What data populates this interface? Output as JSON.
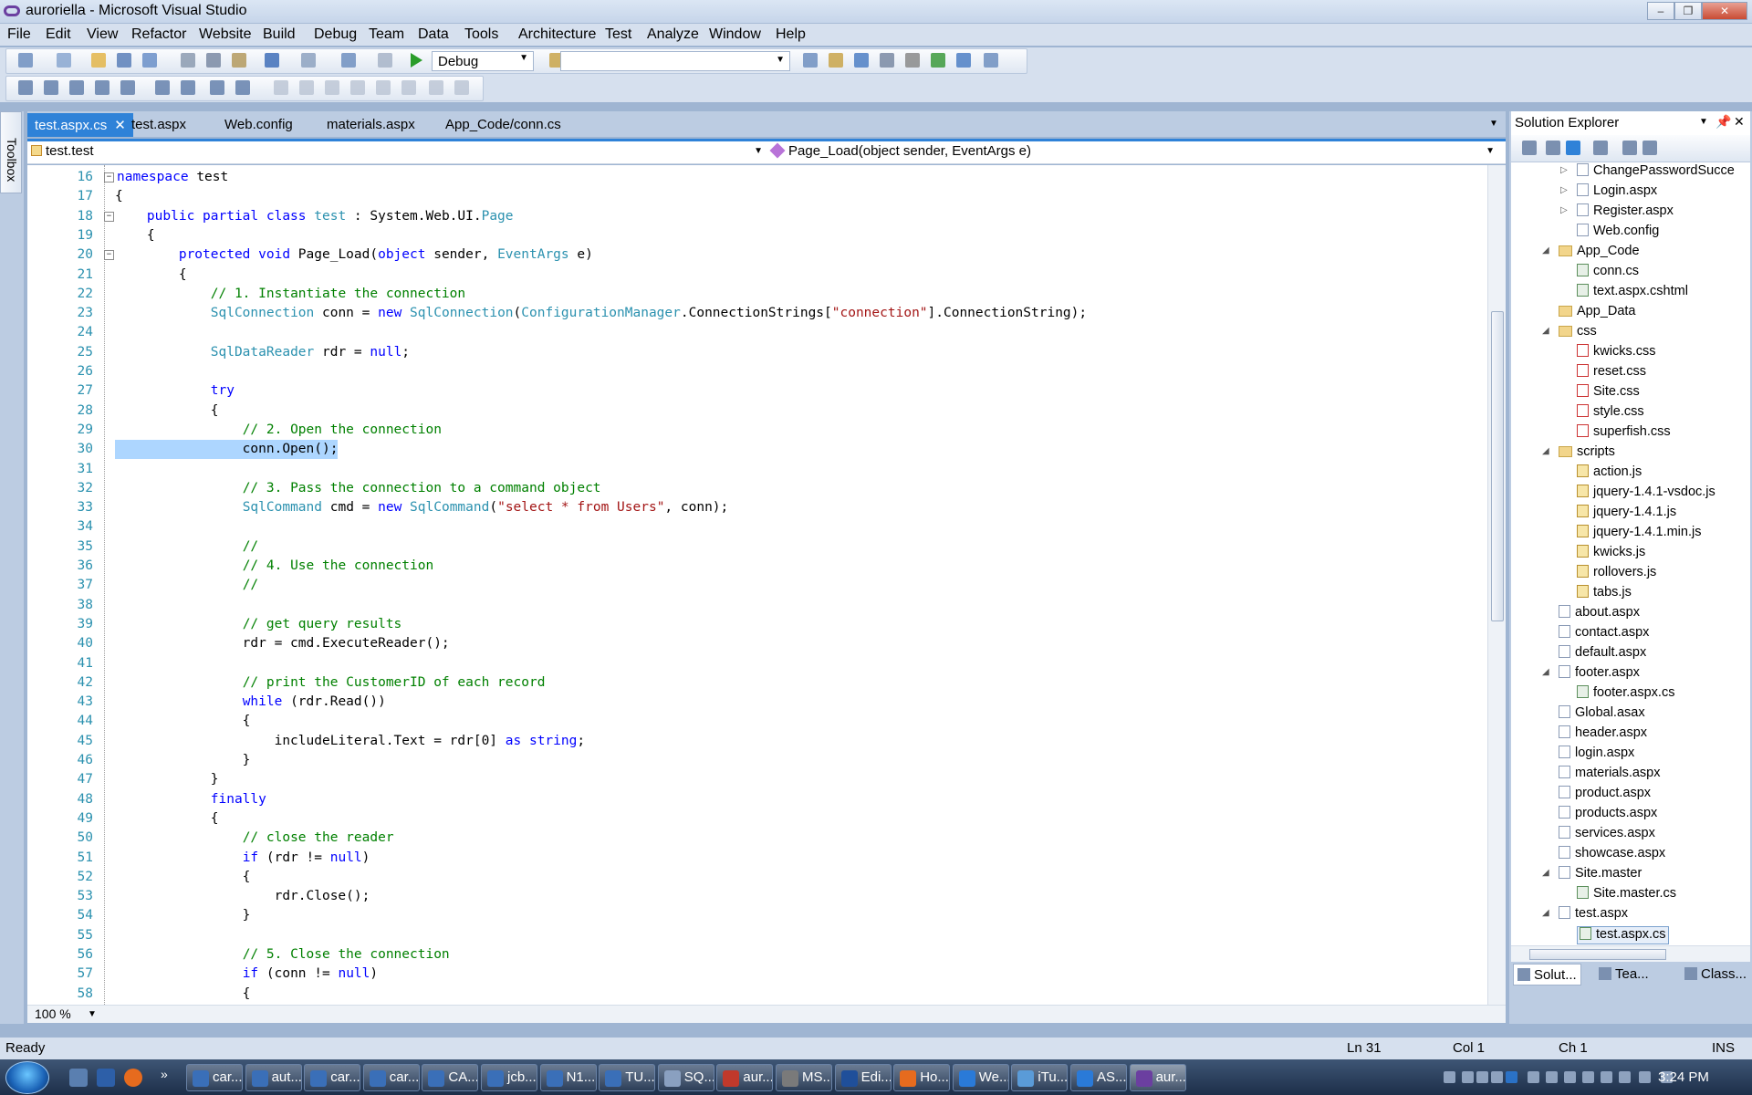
{
  "window": {
    "title": "auroriella - Microsoft Visual Studio",
    "minimize": "–",
    "maximize": "❐",
    "close": "✕"
  },
  "menu": [
    "File",
    "Edit",
    "View",
    "Refactor",
    "Website",
    "Build",
    "Debug",
    "Team",
    "Data",
    "Tools",
    "Architecture",
    "Test",
    "Analyze",
    "Window",
    "Help"
  ],
  "toolbar": {
    "config": "Debug",
    "start_icon": "play-icon"
  },
  "toolbox": {
    "label": "Toolbox"
  },
  "tabs": [
    {
      "label": "test.aspx.cs",
      "active": true
    },
    {
      "label": "test.aspx"
    },
    {
      "label": "Web.config"
    },
    {
      "label": "materials.aspx"
    },
    {
      "label": "App_Code/conn.cs"
    }
  ],
  "nav": {
    "class_combo": "test.test",
    "member_combo": "Page_Load(object sender, EventArgs e)"
  },
  "editor": {
    "zoom": "100 %",
    "lines": [
      {
        "n": "16",
        "fold": "-",
        "t": [
          [
            "kw",
            "namespace"
          ],
          [
            "",
            "test"
          ]
        ],
        "indent": 0,
        "raw": true
      },
      {
        "n": "17",
        "t": [
          [
            "",
            "{"
          ]
        ]
      },
      {
        "n": "18",
        "fold": "-",
        "t": [
          [
            "",
            "    "
          ],
          [
            "kw",
            "public partial class"
          ],
          [
            "",
            " "
          ],
          [
            "ty",
            "test"
          ],
          [
            "",
            " : System.Web.UI."
          ],
          [
            "ty",
            "Page"
          ]
        ]
      },
      {
        "n": "19",
        "t": [
          [
            "",
            "    {"
          ]
        ]
      },
      {
        "n": "20",
        "fold": "-",
        "t": [
          [
            "",
            "        "
          ],
          [
            "kw",
            "protected void"
          ],
          [
            "",
            " Page_Load("
          ],
          [
            "kw",
            "object"
          ],
          [
            "",
            " sender, "
          ],
          [
            "ty",
            "EventArgs"
          ],
          [
            "",
            " e)"
          ]
        ]
      },
      {
        "n": "21",
        "t": [
          [
            "",
            "        {"
          ]
        ]
      },
      {
        "n": "22",
        "t": [
          [
            "",
            "            "
          ],
          [
            "cm",
            "// 1. Instantiate the connection"
          ]
        ]
      },
      {
        "n": "23",
        "t": [
          [
            "",
            "            "
          ],
          [
            "ty",
            "SqlConnection"
          ],
          [
            "",
            " conn = "
          ],
          [
            "kw",
            "new"
          ],
          [
            "",
            " "
          ],
          [
            "ty",
            "SqlConnection"
          ],
          [
            "",
            "("
          ],
          [
            "ty",
            "ConfigurationManager"
          ],
          [
            "",
            ".ConnectionStrings["
          ],
          [
            "st",
            "\"connection\""
          ],
          [
            "",
            "].ConnectionString);"
          ]
        ]
      },
      {
        "n": "24",
        "t": [
          [
            "",
            ""
          ]
        ]
      },
      {
        "n": "25",
        "t": [
          [
            "",
            "            "
          ],
          [
            "ty",
            "SqlDataReader"
          ],
          [
            "",
            " rdr = "
          ],
          [
            "kw",
            "null"
          ],
          [
            "",
            ";"
          ]
        ]
      },
      {
        "n": "26",
        "t": [
          [
            "",
            ""
          ]
        ]
      },
      {
        "n": "27",
        "t": [
          [
            "",
            "            "
          ],
          [
            "kw",
            "try"
          ]
        ]
      },
      {
        "n": "28",
        "t": [
          [
            "",
            "            {"
          ]
        ]
      },
      {
        "n": "29",
        "t": [
          [
            "",
            "                "
          ],
          [
            "cm",
            "// 2. Open the connection"
          ]
        ]
      },
      {
        "n": "30",
        "hl": true,
        "t": [
          [
            "",
            "                conn.Open();"
          ]
        ]
      },
      {
        "n": "31",
        "t": [
          [
            "",
            ""
          ]
        ]
      },
      {
        "n": "32",
        "t": [
          [
            "",
            "                "
          ],
          [
            "cm",
            "// 3. Pass the connection to a command object"
          ]
        ]
      },
      {
        "n": "33",
        "t": [
          [
            "",
            "                "
          ],
          [
            "ty",
            "SqlCommand"
          ],
          [
            "",
            " cmd = "
          ],
          [
            "kw",
            "new"
          ],
          [
            "",
            " "
          ],
          [
            "ty",
            "SqlCommand"
          ],
          [
            "",
            "("
          ],
          [
            "st",
            "\"select * from Users\""
          ],
          [
            "",
            ", conn);"
          ]
        ]
      },
      {
        "n": "34",
        "t": [
          [
            "",
            ""
          ]
        ]
      },
      {
        "n": "35",
        "t": [
          [
            "",
            "                "
          ],
          [
            "cm",
            "//"
          ]
        ]
      },
      {
        "n": "36",
        "t": [
          [
            "",
            "                "
          ],
          [
            "cm",
            "// 4. Use the connection"
          ]
        ]
      },
      {
        "n": "37",
        "t": [
          [
            "",
            "                "
          ],
          [
            "cm",
            "//"
          ]
        ]
      },
      {
        "n": "38",
        "t": [
          [
            "",
            ""
          ]
        ]
      },
      {
        "n": "39",
        "t": [
          [
            "",
            "                "
          ],
          [
            "cm",
            "// get query results"
          ]
        ]
      },
      {
        "n": "40",
        "t": [
          [
            "",
            "                rdr = cmd.ExecuteReader();"
          ]
        ]
      },
      {
        "n": "41",
        "t": [
          [
            "",
            ""
          ]
        ]
      },
      {
        "n": "42",
        "t": [
          [
            "",
            "                "
          ],
          [
            "cm",
            "// print the CustomerID of each record"
          ]
        ]
      },
      {
        "n": "43",
        "t": [
          [
            "",
            "                "
          ],
          [
            "kw",
            "while"
          ],
          [
            "",
            " (rdr.Read())"
          ]
        ]
      },
      {
        "n": "44",
        "t": [
          [
            "",
            "                {"
          ]
        ]
      },
      {
        "n": "45",
        "t": [
          [
            "",
            "                    includeLiteral.Text = rdr[0] "
          ],
          [
            "kw",
            "as"
          ],
          [
            "",
            " "
          ],
          [
            "kw",
            "string"
          ],
          [
            "",
            ";"
          ]
        ]
      },
      {
        "n": "46",
        "t": [
          [
            "",
            "                }"
          ]
        ]
      },
      {
        "n": "47",
        "t": [
          [
            "",
            "            }"
          ]
        ]
      },
      {
        "n": "48",
        "t": [
          [
            "",
            "            "
          ],
          [
            "kw",
            "finally"
          ]
        ]
      },
      {
        "n": "49",
        "t": [
          [
            "",
            "            {"
          ]
        ]
      },
      {
        "n": "50",
        "t": [
          [
            "",
            "                "
          ],
          [
            "cm",
            "// close the reader"
          ]
        ]
      },
      {
        "n": "51",
        "t": [
          [
            "",
            "                "
          ],
          [
            "kw",
            "if"
          ],
          [
            "",
            " (rdr != "
          ],
          [
            "kw",
            "null"
          ],
          [
            "",
            ")"
          ]
        ]
      },
      {
        "n": "52",
        "t": [
          [
            "",
            "                {"
          ]
        ]
      },
      {
        "n": "53",
        "t": [
          [
            "",
            "                    rdr.Close();"
          ]
        ]
      },
      {
        "n": "54",
        "t": [
          [
            "",
            "                }"
          ]
        ]
      },
      {
        "n": "55",
        "t": [
          [
            "",
            ""
          ]
        ]
      },
      {
        "n": "56",
        "t": [
          [
            "",
            "                "
          ],
          [
            "cm",
            "// 5. Close the connection"
          ]
        ]
      },
      {
        "n": "57",
        "t": [
          [
            "",
            "                "
          ],
          [
            "kw",
            "if"
          ],
          [
            "",
            " (conn != "
          ],
          [
            "kw",
            "null"
          ],
          [
            "",
            ")"
          ]
        ]
      },
      {
        "n": "58",
        "t": [
          [
            "",
            "                {"
          ]
        ]
      }
    ]
  },
  "solution_explorer": {
    "title": "Solution Explorer",
    "items": [
      {
        "label": "ChangePasswordSucce",
        "depth": 2,
        "icon": "page",
        "exp": "▷"
      },
      {
        "label": "Login.aspx",
        "depth": 2,
        "icon": "page",
        "exp": "▷"
      },
      {
        "label": "Register.aspx",
        "depth": 2,
        "icon": "page",
        "exp": "▷"
      },
      {
        "label": "Web.config",
        "depth": 2,
        "icon": "page"
      },
      {
        "label": "App_Code",
        "depth": 1,
        "icon": "folder",
        "exp": "◢"
      },
      {
        "label": "conn.cs",
        "depth": 2,
        "icon": "cs"
      },
      {
        "label": "text.aspx.cshtml",
        "depth": 2,
        "icon": "cs"
      },
      {
        "label": "App_Data",
        "depth": 1,
        "icon": "folder"
      },
      {
        "label": "css",
        "depth": 1,
        "icon": "folder",
        "exp": "◢"
      },
      {
        "label": "kwicks.css",
        "depth": 2,
        "icon": "css"
      },
      {
        "label": "reset.css",
        "depth": 2,
        "icon": "css"
      },
      {
        "label": "Site.css",
        "depth": 2,
        "icon": "css"
      },
      {
        "label": "style.css",
        "depth": 2,
        "icon": "css"
      },
      {
        "label": "superfish.css",
        "depth": 2,
        "icon": "css"
      },
      {
        "label": "scripts",
        "depth": 1,
        "icon": "folder",
        "exp": "◢"
      },
      {
        "label": "action.js",
        "depth": 2,
        "icon": "js"
      },
      {
        "label": "jquery-1.4.1-vsdoc.js",
        "depth": 2,
        "icon": "js"
      },
      {
        "label": "jquery-1.4.1.js",
        "depth": 2,
        "icon": "js"
      },
      {
        "label": "jquery-1.4.1.min.js",
        "depth": 2,
        "icon": "js"
      },
      {
        "label": "kwicks.js",
        "depth": 2,
        "icon": "js"
      },
      {
        "label": "rollovers.js",
        "depth": 2,
        "icon": "js"
      },
      {
        "label": "tabs.js",
        "depth": 2,
        "icon": "js"
      },
      {
        "label": "about.aspx",
        "depth": 1,
        "icon": "page"
      },
      {
        "label": "contact.aspx",
        "depth": 1,
        "icon": "page"
      },
      {
        "label": "default.aspx",
        "depth": 1,
        "icon": "page"
      },
      {
        "label": "footer.aspx",
        "depth": 1,
        "icon": "page",
        "exp": "◢"
      },
      {
        "label": "footer.aspx.cs",
        "depth": 2,
        "icon": "cs"
      },
      {
        "label": "Global.asax",
        "depth": 1,
        "icon": "page"
      },
      {
        "label": "header.aspx",
        "depth": 1,
        "icon": "page"
      },
      {
        "label": "login.aspx",
        "depth": 1,
        "icon": "page"
      },
      {
        "label": "materials.aspx",
        "depth": 1,
        "icon": "page"
      },
      {
        "label": "product.aspx",
        "depth": 1,
        "icon": "page"
      },
      {
        "label": "products.aspx",
        "depth": 1,
        "icon": "page"
      },
      {
        "label": "services.aspx",
        "depth": 1,
        "icon": "page"
      },
      {
        "label": "showcase.aspx",
        "depth": 1,
        "icon": "page"
      },
      {
        "label": "Site.master",
        "depth": 1,
        "icon": "page",
        "exp": "◢"
      },
      {
        "label": "Site.master.cs",
        "depth": 2,
        "icon": "cs"
      },
      {
        "label": "test.aspx",
        "depth": 1,
        "icon": "page",
        "exp": "◢"
      },
      {
        "label": "test.aspx.cs",
        "depth": 2,
        "icon": "cs",
        "selected": true
      },
      {
        "label": "Web.config",
        "depth": 1,
        "icon": "page"
      }
    ],
    "bottom_tabs": [
      "Solut...",
      "Tea...",
      "Class..."
    ]
  },
  "status": {
    "ready": "Ready",
    "ln": "Ln 31",
    "col": "Col 1",
    "ch": "Ch 1",
    "ins": "INS"
  },
  "taskbar": {
    "buttons": [
      "car...",
      "aut...",
      "car...",
      "car...",
      "CA...",
      "jcb...",
      "N1...",
      "TU...",
      "SQ...",
      "aur...",
      "MS...",
      "Edi...",
      "Ho...",
      "We...",
      "iTu...",
      "AS...",
      "aur..."
    ],
    "clock": "3:24 PM"
  }
}
